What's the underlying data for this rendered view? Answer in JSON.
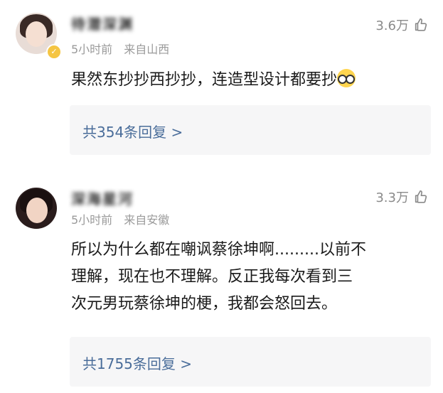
{
  "comments": [
    {
      "username": "待潜深渊",
      "time": "5小时前",
      "location": "来自山西",
      "likes": "3.6万",
      "content": "果然东抄抄西抄抄，连造型设计都要抄",
      "emoji": "nerd-glasses-emoji",
      "replies": "共354条回复 >"
    },
    {
      "username": "深海星河",
      "time": "5小时前",
      "location": "来自安徽",
      "likes": "3.3万",
      "content_line1": "所以为什么都在嘲讽蔡徐坤啊.........以前不",
      "content_line2": "理解，现在也不理解。反正我每次看到三",
      "content_line3": "次元男玩蔡徐坤的梗，我都会怒回去。",
      "replies": "共1755条回复 >"
    }
  ],
  "icons": {
    "like": "thumbs-up-outline-icon",
    "verified": "verified-badge-icon"
  },
  "colors": {
    "link": "#4a6d9a",
    "meta": "#9a9a9a",
    "reply_bg": "#f6f6f7"
  }
}
